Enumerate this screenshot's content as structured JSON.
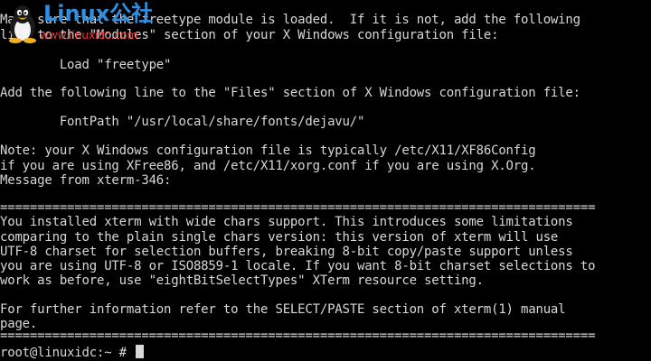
{
  "terminal": {
    "lines": [
      "Make sure that the freetype module is loaded.  If it is not, add the following",
      "line to the \"Modules\" section of your X Windows configuration file:",
      "",
      "        Load \"freetype\"",
      "",
      "Add the following line to the \"Files\" section of X Windows configuration file:",
      "",
      "        FontPath \"/usr/local/share/fonts/dejavu/\"",
      "",
      "Note: your X Windows configuration file is typically /etc/X11/XF86Config",
      "if you are using XFree86, and /etc/X11/xorg.conf if you are using X.Org.",
      "Message from xterm-346:",
      "",
      "================================================================================",
      "You installed xterm with wide chars support. This introduces some limitations",
      "comparing to the plain single chars version: this version of xterm will use",
      "UTF-8 charset for selection buffers, breaking 8-bit copy/paste support unless",
      "you are using UTF-8 or ISO8859-1 locale. If you want 8-bit charset selections to",
      "work as before, use \"eightBitSelectTypes\" XTerm resource setting.",
      "",
      "For further information refer to the SELECT/PASTE section of xterm(1) manual",
      "page.",
      "================================================================================",
      "root@linuxidc:~ # "
    ],
    "text_color": "#d8d8d8",
    "background_color": "#000000"
  },
  "watermark": {
    "logo_text": "Linux公社",
    "url": "www.linuxidc.com",
    "icon": "tux-penguin-icon",
    "logo_color": "#2f8fe0",
    "url_color": "#e23b3b"
  }
}
